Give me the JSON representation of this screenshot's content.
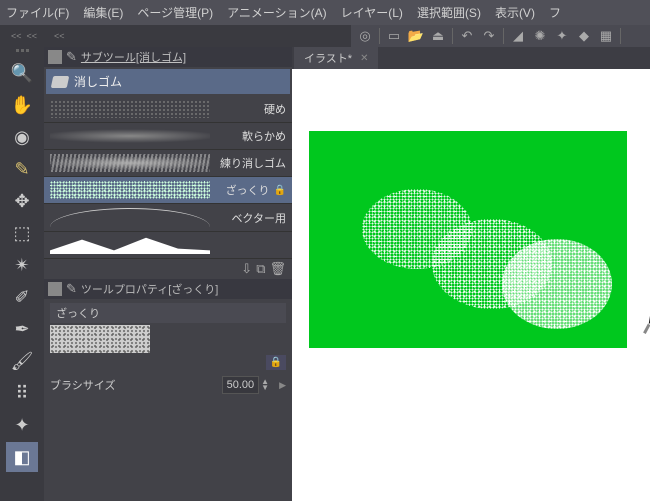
{
  "menu": {
    "file": "ファイル(F)",
    "edit": "編集(E)",
    "page": "ページ管理(P)",
    "anim": "アニメーション(A)",
    "layer": "レイヤー(L)",
    "sel": "選択範囲(S)",
    "view": "表示(V)",
    "etc": "フ"
  },
  "subToolPanel": {
    "title": "サブツール[消しゴム]",
    "group": "消しゴム"
  },
  "brushes": [
    {
      "label": "硬め"
    },
    {
      "label": "軟らかめ"
    },
    {
      "label": "練り消しゴム"
    },
    {
      "label": "ざっくり",
      "locked": true,
      "selected": true
    },
    {
      "label": "ベクター用"
    },
    {
      "label": ""
    }
  ],
  "propPanel": {
    "title": "ツールプロパティ[ざっくり]",
    "name": "ざっくり",
    "sizeLabel": "ブラシサイズ",
    "sizeValue": "50.00"
  },
  "canvasTab": {
    "name": "イラスト*"
  }
}
